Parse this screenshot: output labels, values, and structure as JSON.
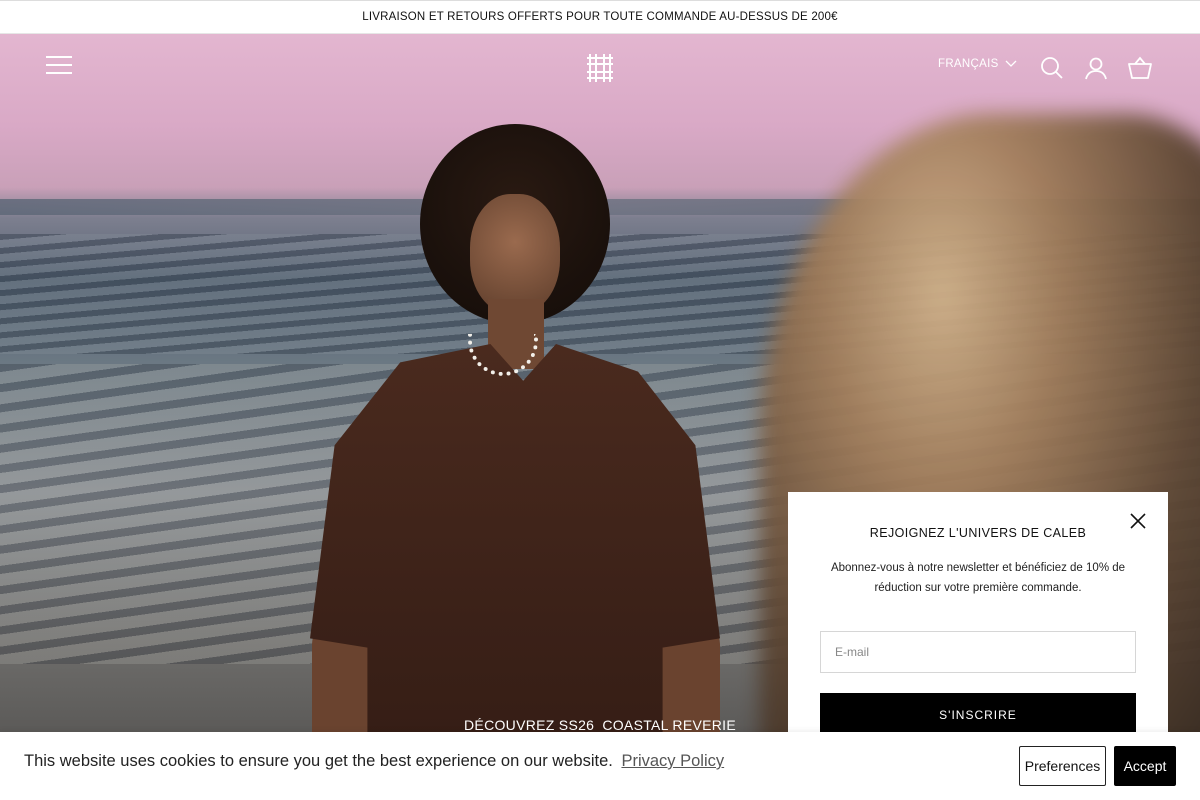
{
  "announcement": {
    "text": "LIVRAISON ET RETOURS OFFERTS POUR TOUTE COMMANDE AU-DESSUS DE 200€"
  },
  "header": {
    "language": "FRANÇAIS",
    "icons": [
      "menu-icon",
      "search-icon",
      "account-icon",
      "cart-icon",
      "chevron-down-icon"
    ]
  },
  "hero": {
    "cta": "DÉCOUVREZ SS26_COASTAL REVERIE"
  },
  "newsletter": {
    "title": "REJOIGNEZ L'UNIVERS DE CALEB",
    "text": "Abonnez-vous à notre newsletter et bénéficiez de 10% de réduction sur votre première commande.",
    "email_placeholder": "E-mail",
    "submit": "S'INSCRIRE"
  },
  "cookie": {
    "text": "This website uses cookies to ensure you get the best experience on our website.",
    "link": "Privacy Policy",
    "preferences": "Preferences",
    "accept": "Accept"
  }
}
